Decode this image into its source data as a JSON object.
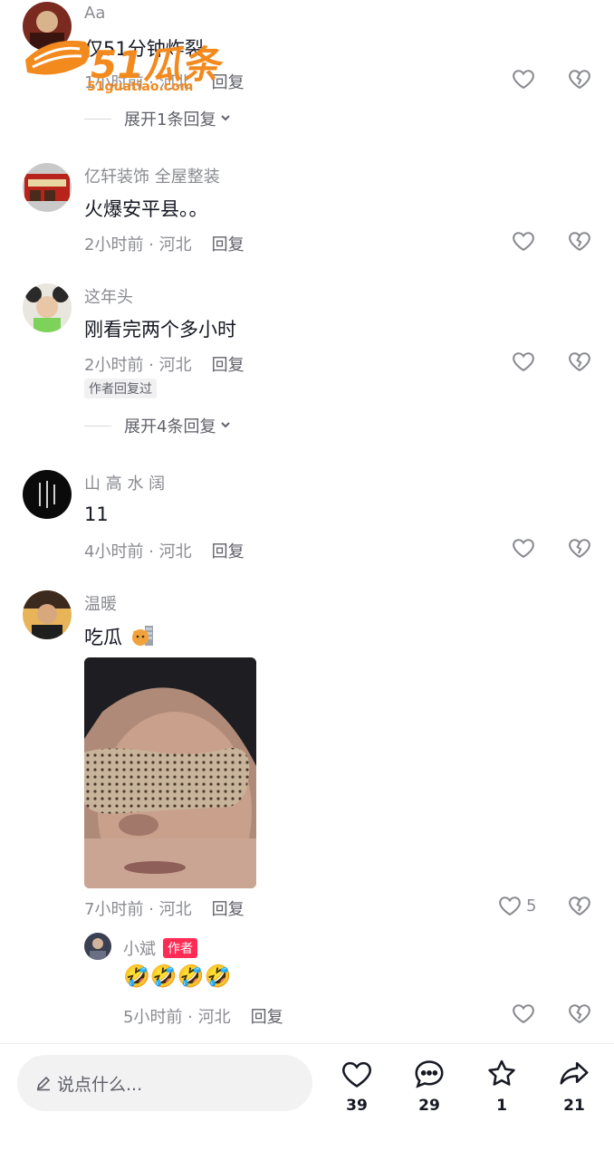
{
  "watermark": {
    "brand": "51瓜条",
    "domain": "51guatiao.com"
  },
  "comments": [
    {
      "username": "Aa",
      "text": "仅51分钟炸裂",
      "meta": "1小时前 · 河北",
      "reply_label": "回复",
      "expand_label": "展开1条回复"
    },
    {
      "username": "亿轩装饰  全屋整装",
      "text": "火爆安平县。。",
      "meta": "2小时前 · 河北",
      "reply_label": "回复"
    },
    {
      "username": "这年头",
      "text": "刚看完两个多小时",
      "meta": "2小时前 · 河北",
      "reply_label": "回复",
      "badge": "作者回复过",
      "expand_label": "展开4条回复"
    },
    {
      "username": "山 高 水 阔",
      "text": "11",
      "meta": "4小时前 · 河北",
      "reply_label": "回复"
    },
    {
      "username": "温暖",
      "text": "吃瓜",
      "meta": "7小时前 · 河北",
      "reply_label": "回复",
      "like_count": "5"
    }
  ],
  "sub_reply": {
    "username": "小斌",
    "author_tag": "作者",
    "text": "🤣🤣🤣🤣",
    "meta": "5小时前 · 河北",
    "reply_label": "回复"
  },
  "bottom_bar": {
    "input_placeholder": "说点什么...",
    "like_count": "39",
    "comment_count": "29",
    "favorite_count": "1",
    "share_count": "21"
  }
}
